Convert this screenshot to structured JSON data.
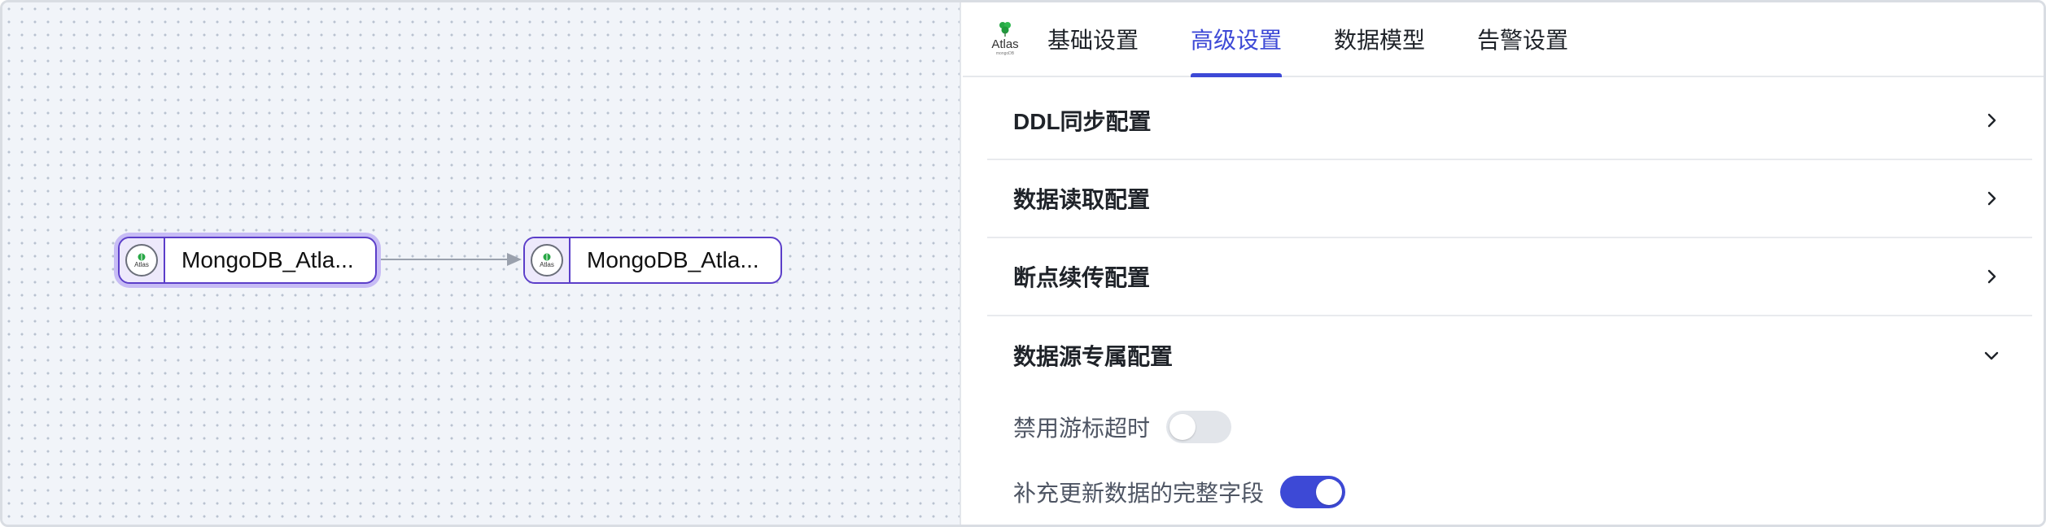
{
  "canvas": {
    "nodes": [
      {
        "label": "MongoDB_Atla...",
        "icon_text": "Atlas",
        "selected": true
      },
      {
        "label": "MongoDB_Atla...",
        "icon_text": "Atlas",
        "selected": false
      }
    ]
  },
  "panel": {
    "logo": {
      "text": "Atlas",
      "subtext": "mongoDB"
    },
    "tabs": [
      {
        "label": "基础设置",
        "active": false
      },
      {
        "label": "高级设置",
        "active": true
      },
      {
        "label": "数据模型",
        "active": false
      },
      {
        "label": "告警设置",
        "active": false
      }
    ],
    "sections": [
      {
        "title": "DDL同步配置",
        "expanded": false
      },
      {
        "title": "数据读取配置",
        "expanded": false
      },
      {
        "title": "断点续传配置",
        "expanded": false
      },
      {
        "title": "数据源专属配置",
        "expanded": true
      }
    ],
    "settings": [
      {
        "label": "禁用游标超时",
        "enabled": false
      },
      {
        "label": "补充更新数据的完整字段",
        "enabled": true
      }
    ]
  },
  "colors": {
    "accent": "#3d49d6",
    "node_border": "#5b3ec9",
    "leaf_green": "#27a745"
  },
  "icons": [
    "atlas-logo-icon",
    "chevron-right-icon",
    "chevron-down-icon",
    "arrow-edge"
  ]
}
